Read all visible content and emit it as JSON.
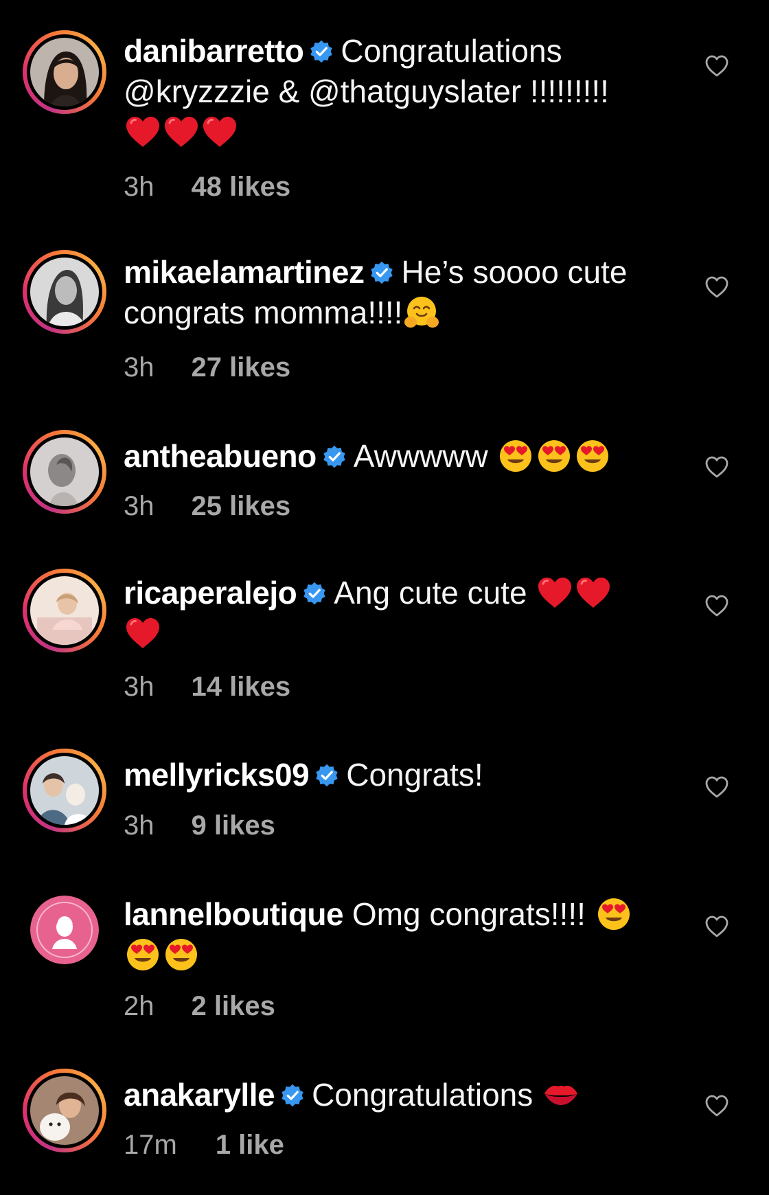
{
  "colors": {
    "background": "#000000",
    "text": "#f5f5f5",
    "meta": "#a8a8a8",
    "verified": "#3897f0",
    "ring_gradient": [
      "#c13584",
      "#e1306c",
      "#f77737",
      "#fcaf45"
    ]
  },
  "comments": [
    {
      "username": "danibarretto",
      "verified": true,
      "text": "Congratulations @kryzzzie & @thatguyslater !!!!!!!!!",
      "emojis": [
        "red-heart",
        "red-heart",
        "red-heart"
      ],
      "time": "3h",
      "likes": "48 likes"
    },
    {
      "username": "mikaelamartinez",
      "verified": true,
      "text": "He’s soooo cute congrats momma!!!!",
      "emojis": [
        "hugging-face"
      ],
      "time": "3h",
      "likes": "27 likes"
    },
    {
      "username": "antheabueno",
      "verified": true,
      "text": "Awwwww",
      "emojis": [
        "heart-eyes",
        "heart-eyes",
        "heart-eyes"
      ],
      "time": "3h",
      "likes": "25 likes"
    },
    {
      "username": "ricaperalejo",
      "verified": true,
      "text": "Ang cute cute",
      "emojis": [
        "red-heart",
        "red-heart",
        "red-heart"
      ],
      "time": "3h",
      "likes": "14 likes"
    },
    {
      "username": "mellyricks09",
      "verified": true,
      "text": "Congrats!",
      "emojis": [],
      "time": "3h",
      "likes": "9 likes"
    },
    {
      "username": "lannelboutique",
      "verified": false,
      "text": "Omg congrats!!!!",
      "emojis": [
        "heart-eyes",
        "heart-eyes",
        "heart-eyes"
      ],
      "time": "2h",
      "likes": "2 likes"
    },
    {
      "username": "anakarylle",
      "verified": true,
      "text": "Congratulations",
      "emojis": [
        "kiss-mark"
      ],
      "time": "17m",
      "likes": "1 like"
    }
  ]
}
